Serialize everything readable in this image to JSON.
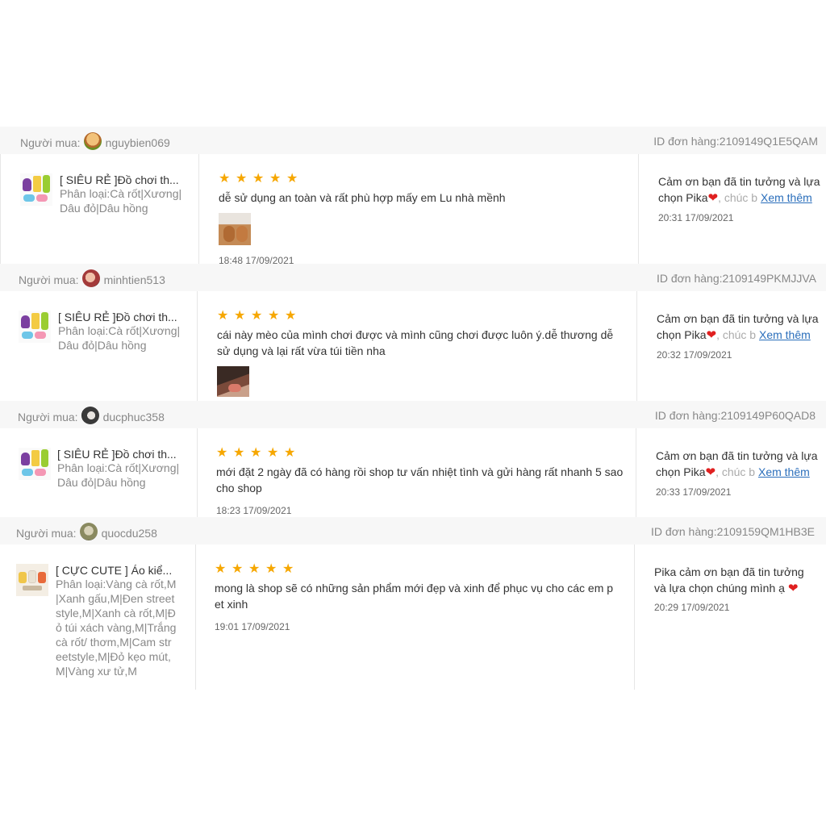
{
  "labels": {
    "buyer_label": "Người mua:",
    "rating_icon": "star-icon"
  },
  "colors": {
    "star": "#f6a700",
    "heart": "#e02020",
    "link": "#2a6ebb",
    "header_bg": "#f7f7f7"
  },
  "reviews": [
    {
      "username": "nguybien069",
      "order_id": "ID đơn hàng:2109149Q1E5QAM",
      "product_title": "[ SIÊU RẺ ]Đồ chơi th...",
      "variation": "Phân loại:Cà rốt|Xương|Dâu đỏ|Dâu hồng",
      "stars": 5,
      "comment": "dễ sử dụng an toàn và rất phù hợp mấy em Lu nhà mềnh",
      "time": "18:48 17/09/2021",
      "reply_text": "Cảm ơn bạn đã tin tưởng và lựa chọn Pika",
      "reply_more_text": ", chúc b",
      "reply_link": "Xem thêm",
      "reply_time": "20:31 17/09/2021"
    },
    {
      "username": "minhtien513",
      "order_id": "ID đơn hàng:2109149PKMJJVA",
      "product_title": "[ SIÊU RẺ ]Đồ chơi th...",
      "variation": "Phân loại:Cà rốt|Xương|Dâu đỏ|Dâu hồng",
      "stars": 5,
      "comment": "cái này mèo của mình chơi được và mình cũng chơi được luôn ý.dễ thương dễ sử dụng và lại rất vừa túi tiền nha",
      "reply_text": "Cảm ơn bạn đã tin tưởng và lựa chọn Pika",
      "reply_more_text": ", chúc b",
      "reply_link": "Xem thêm",
      "reply_time": "20:32 17/09/2021"
    },
    {
      "username": "ducphuc358",
      "order_id": "ID đơn hàng:2109149P60QAD8",
      "product_title": "[ SIÊU RẺ ]Đồ chơi th...",
      "variation": "Phân loại:Cà rốt|Xương|Dâu đỏ|Dâu hồng",
      "stars": 5,
      "comment": "mới đặt 2 ngày đã có hàng rồi shop tư vấn nhiệt tình và gửi hàng rất nhanh 5 sao cho shop",
      "time": "18:23 17/09/2021",
      "reply_text": "Cảm ơn bạn đã tin tưởng và lựa chọn Pika",
      "reply_more_text": ", chúc b",
      "reply_link": "Xem thêm",
      "reply_time": "20:33 17/09/2021"
    },
    {
      "username": "quocdu258",
      "order_id": "ID đơn hàng:2109159QM1HB3E",
      "product_title": "[ CỰC CUTE ] Áo kiể...",
      "variation": "Phân loại:Vàng cà rốt,M|Xanh gấu,M|Đen street style,M|Xanh cà rốt,M|Đỏ túi xách vàng,M|Trắng cà rốt/ thơm,M|Cam streetstyle,M|Đỏ kẹo mút,M|Vàng xư tử,M",
      "stars": 5,
      "comment": "mong là shop sẽ có những sản phẩm mới đẹp và xinh để phục vụ cho các em pet xinh",
      "time": "19:01 17/09/2021",
      "reply_text": "Pika cảm ơn bạn đã tin tưởng và lựa chọn chúng mình ạ",
      "reply_time": "20:29 17/09/2021"
    }
  ]
}
